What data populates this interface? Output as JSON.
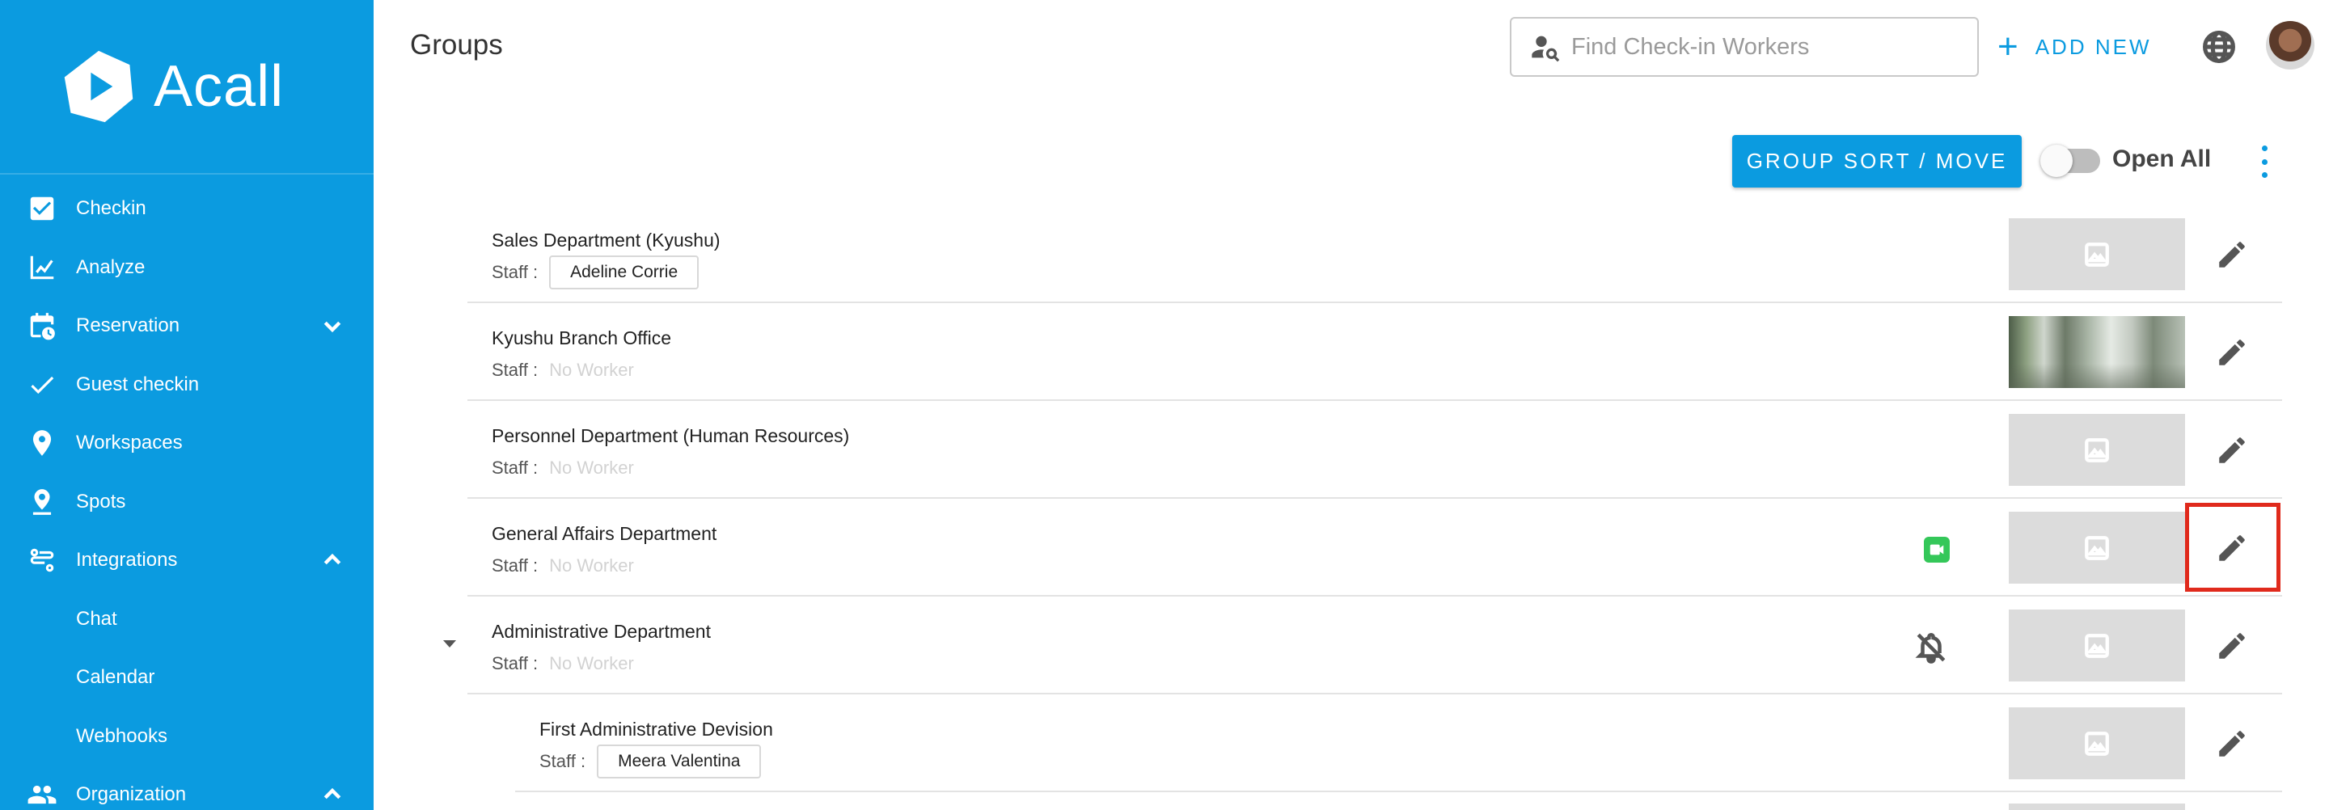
{
  "brand": {
    "name": "Acall"
  },
  "sidebar": {
    "items": [
      {
        "label": "Checkin",
        "icon": "checkbox-icon"
      },
      {
        "label": "Analyze",
        "icon": "chart-line-icon"
      },
      {
        "label": "Reservation",
        "icon": "calendar-clock-icon",
        "expandable": "collapsed"
      },
      {
        "label": "Guest checkin",
        "icon": "check-icon"
      },
      {
        "label": "Workspaces",
        "icon": "location-pin-icon"
      },
      {
        "label": "Spots",
        "icon": "person-pin-icon"
      },
      {
        "label": "Integrations",
        "icon": "integrations-icon",
        "expandable": "expanded"
      },
      {
        "label": "Chat",
        "sub": true
      },
      {
        "label": "Calendar",
        "sub": true
      },
      {
        "label": "Webhooks",
        "sub": true
      },
      {
        "label": "Organization",
        "icon": "people-icon",
        "expandable": "expanded"
      }
    ]
  },
  "header": {
    "title": "Groups",
    "search_placeholder": "Find Check-in Workers",
    "add_new_label": "ADD NEW"
  },
  "toolbar": {
    "sort_move_label": "GROUP SORT / MOVE",
    "open_all_label": "Open All",
    "open_all_on": false
  },
  "groups": {
    "staff_label": "Staff :",
    "no_worker": "No Worker",
    "rows": [
      {
        "name": "Sales Department (Kyushu)",
        "worker": "Adeline Corrie",
        "thumb": "placeholder"
      },
      {
        "name": "Kyushu Branch Office",
        "worker": "",
        "thumb": "photo"
      },
      {
        "name": "Personnel Department (Human Resources)",
        "worker": "",
        "thumb": "placeholder"
      },
      {
        "name": "General Affairs Department",
        "worker": "",
        "thumb": "placeholder",
        "video": true,
        "highlighted": true
      },
      {
        "name": "Administrative Department",
        "worker": "",
        "thumb": "placeholder",
        "bell_off": true,
        "expanded": true
      },
      {
        "name": "First Administrative Devision",
        "worker": "Meera Valentina",
        "thumb": "placeholder",
        "child": true
      }
    ]
  },
  "colors": {
    "accent": "#0b9be0",
    "highlight": "#e02a1c",
    "video": "#34c759"
  }
}
